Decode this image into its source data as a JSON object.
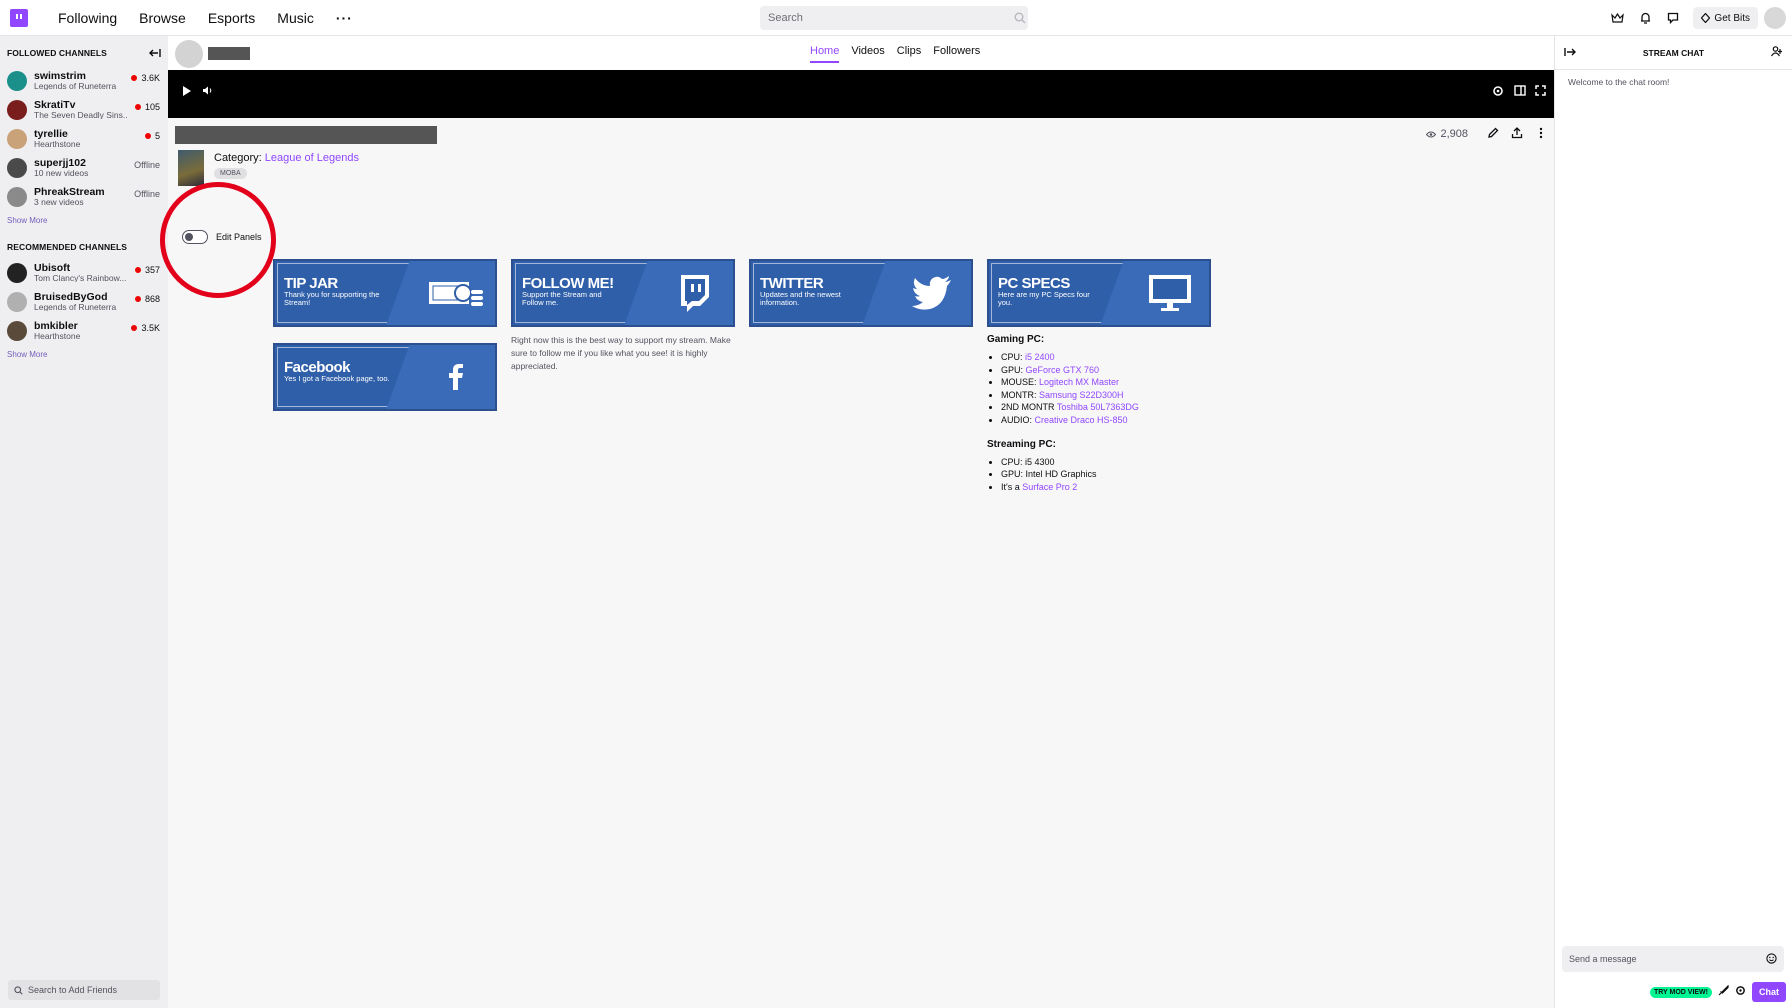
{
  "nav": {
    "links": [
      "Following",
      "Browse",
      "Esports",
      "Music"
    ],
    "more": "···",
    "search_placeholder": "Search",
    "get_bits": "Get Bits"
  },
  "sidebar": {
    "followed_header": "FOLLOWED CHANNELS",
    "followed": [
      {
        "name": "swimstrim",
        "sub": "Legends of Runeterra",
        "status": "3.6K",
        "live": true,
        "color": "#1b8f8a"
      },
      {
        "name": "SkratiTv",
        "sub": "The Seven Deadly Sins...",
        "status": "105",
        "live": true,
        "color": "#7a1d1d"
      },
      {
        "name": "tyrellie",
        "sub": "Hearthstone",
        "status": "5",
        "live": true,
        "color": "#c9a27a"
      },
      {
        "name": "superjj102",
        "sub": "10 new videos",
        "status": "Offline",
        "live": false,
        "color": "#4a4a4a"
      },
      {
        "name": "PhreakStream",
        "sub": "3 new videos",
        "status": "Offline",
        "live": false,
        "color": "#8a8a8a"
      }
    ],
    "show_more_1": "Show More",
    "recommended_header": "RECOMMENDED CHANNELS",
    "recommended": [
      {
        "name": "Ubisoft",
        "sub": "Tom Clancy's Rainbow...",
        "status": "357",
        "live": true,
        "color": "#222"
      },
      {
        "name": "BruisedByGod",
        "sub": "Legends of Runeterra",
        "status": "868",
        "live": true,
        "color": "#b0b0b0"
      },
      {
        "name": "bmkibler",
        "sub": "Hearthstone",
        "status": "3.5K",
        "live": true,
        "color": "#5a4a3a"
      }
    ],
    "show_more_2": "Show More",
    "friends_placeholder": "Search to Add Friends"
  },
  "channel": {
    "tabs": [
      "Home",
      "Videos",
      "Clips",
      "Followers"
    ],
    "active_tab": "Home",
    "category_label": "Category:",
    "category": "League of Legends",
    "tag": "MOBA",
    "viewers": "2,908",
    "edit_panels": "Edit Panels"
  },
  "panels": [
    {
      "title": "TIP JAR",
      "sub": "Thank you for supporting the Stream!",
      "icon": "money-icon"
    },
    {
      "title": "FOLLOW ME!",
      "sub": "Support the Stream and Follow me.",
      "icon": "twitch-icon",
      "desc": "Right now this is the best way to support my stream. Make sure to follow me if you like what you see! it is highly appreciated."
    },
    {
      "title": "TWITTER",
      "sub": "Updates and the newest information.",
      "icon": "twitter-icon"
    },
    {
      "title": "PC SPECS",
      "sub": "Here are my PC Specs four you.",
      "icon": "monitor-icon"
    },
    {
      "title": "Facebook",
      "sub": "Yes I got a Facebook page, too.",
      "icon": "facebook-icon"
    }
  ],
  "specs": {
    "gaming_title": "Gaming PC:",
    "gaming": [
      {
        "label": "CPU: ",
        "value": "i5 2400"
      },
      {
        "label": "GPU: ",
        "value": "GeForce GTX 760"
      },
      {
        "label": "MOUSE: ",
        "value": "Logitech MX Master"
      },
      {
        "label": "MONTR: ",
        "value": "Samsung S22D300H"
      },
      {
        "label": "2ND MONTR ",
        "value": "Toshiba 50L7363DG"
      },
      {
        "label": "AUDIO: ",
        "value": "Creative Draco HS-850"
      }
    ],
    "streaming_title": "Streaming PC:",
    "streaming": [
      {
        "label": "CPU: i5 4300",
        "value": ""
      },
      {
        "label": "GPU: Intel HD Graphics",
        "value": ""
      },
      {
        "label": "It's a ",
        "value": "Surface Pro 2"
      }
    ]
  },
  "chat": {
    "title": "STREAM CHAT",
    "welcome": "Welcome to the chat room!",
    "input_placeholder": "Send a message",
    "mod_badge": "TRY MOD VIEW!",
    "send": "Chat"
  }
}
